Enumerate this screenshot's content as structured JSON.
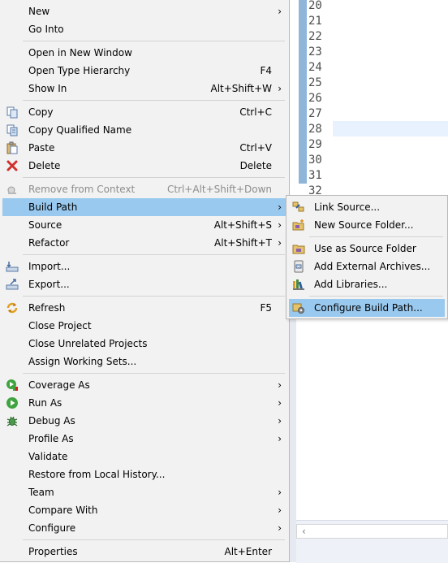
{
  "editor": {
    "line_numbers": [
      "20",
      "21",
      "22",
      "23",
      "24",
      "25",
      "26",
      "27",
      "28",
      "29",
      "30",
      "31",
      "32"
    ],
    "scroll_left_glyph": "‹"
  },
  "menu": {
    "new": {
      "label": "New",
      "arrow": "›"
    },
    "go_into": {
      "label": "Go Into"
    },
    "open_new_window": {
      "label": "Open in New Window"
    },
    "open_type_hierarchy": {
      "label": "Open Type Hierarchy",
      "shortcut": "F4"
    },
    "show_in": {
      "label": "Show In",
      "shortcut": "Alt+Shift+W",
      "arrow": "›"
    },
    "copy": {
      "label": "Copy",
      "shortcut": "Ctrl+C",
      "icon": "copy-icon"
    },
    "copy_qualified": {
      "label": "Copy Qualified Name",
      "icon": "copy-qualified-icon"
    },
    "paste": {
      "label": "Paste",
      "shortcut": "Ctrl+V",
      "icon": "paste-icon"
    },
    "delete": {
      "label": "Delete",
      "shortcut": "Delete",
      "icon": "delete-icon"
    },
    "remove_context": {
      "label": "Remove from Context",
      "shortcut": "Ctrl+Alt+Shift+Down",
      "icon": "remove-context-icon"
    },
    "build_path": {
      "label": "Build Path",
      "arrow": "›"
    },
    "source": {
      "label": "Source",
      "shortcut": "Alt+Shift+S",
      "arrow": "›"
    },
    "refactor": {
      "label": "Refactor",
      "shortcut": "Alt+Shift+T",
      "arrow": "›"
    },
    "import": {
      "label": "Import...",
      "icon": "import-icon"
    },
    "export": {
      "label": "Export...",
      "icon": "export-icon"
    },
    "refresh": {
      "label": "Refresh",
      "shortcut": "F5",
      "icon": "refresh-icon"
    },
    "close_project": {
      "label": "Close Project"
    },
    "close_unrelated": {
      "label": "Close Unrelated Projects"
    },
    "assign_working_sets": {
      "label": "Assign Working Sets..."
    },
    "coverage_as": {
      "label": "Coverage As",
      "arrow": "›",
      "icon": "coverage-icon"
    },
    "run_as": {
      "label": "Run As",
      "arrow": "›",
      "icon": "run-icon"
    },
    "debug_as": {
      "label": "Debug As",
      "arrow": "›",
      "icon": "debug-icon"
    },
    "profile_as": {
      "label": "Profile As",
      "arrow": "›"
    },
    "validate": {
      "label": "Validate"
    },
    "restore_history": {
      "label": "Restore from Local History..."
    },
    "team": {
      "label": "Team",
      "arrow": "›"
    },
    "compare_with": {
      "label": "Compare With",
      "arrow": "›"
    },
    "configure": {
      "label": "Configure",
      "arrow": "›"
    },
    "properties": {
      "label": "Properties",
      "shortcut": "Alt+Enter"
    }
  },
  "submenu": {
    "link_source": {
      "label": "Link Source...",
      "icon": "link-source-icon"
    },
    "new_source_folder": {
      "label": "New Source Folder...",
      "icon": "new-source-folder-icon"
    },
    "use_as_source_folder": {
      "label": "Use as Source Folder",
      "icon": "source-folder-icon"
    },
    "add_external_archives": {
      "label": "Add External Archives...",
      "icon": "archive-icon"
    },
    "add_libraries": {
      "label": "Add Libraries...",
      "icon": "library-icon"
    },
    "configure_build_path": {
      "label": "Configure Build Path...",
      "icon": "configure-build-path-icon"
    }
  },
  "colors": {
    "menu_bg": "#f2f2f2",
    "highlight": "#99c9ef",
    "disabled_text": "#8d8d8d",
    "ruler": "#8fb6d9",
    "current_line": "#e8f2fe"
  }
}
